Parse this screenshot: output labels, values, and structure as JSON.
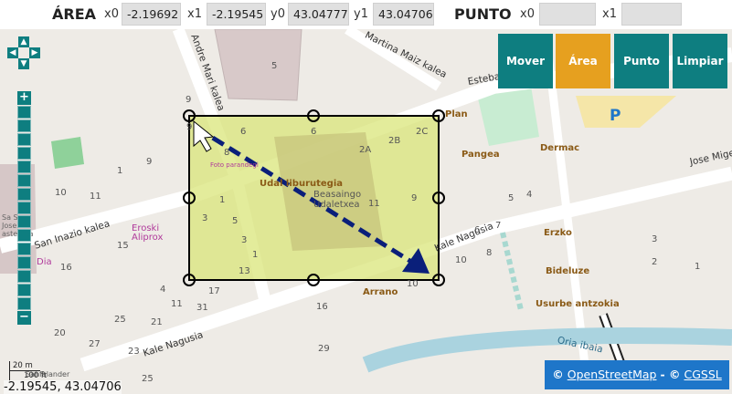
{
  "toolbar": {
    "area_label": "ÁREA",
    "x0_label": "x0",
    "x0_value": "-2.19692",
    "x1_label": "x1",
    "x1_value": "-2.19545",
    "y0_label": "y0",
    "y0_value": "43.04777",
    "y1_label": "y1",
    "y1_value": "43.04706",
    "punto_label": "PUNTO",
    "px0_label": "x0",
    "px0_value": "",
    "px1_label": "x1",
    "px1_value": ""
  },
  "buttons": {
    "mover": "Mover",
    "area": "Área",
    "punto": "Punto",
    "limpiar": "Limpiar"
  },
  "colors": {
    "button": "#0e7e80",
    "active_button": "#e6a01f",
    "selection_fill": "#d9e57a",
    "arrow": "#0a1f7a",
    "attribution": "#1e76c9"
  },
  "map": {
    "streets": {
      "andre": "Andre Mari kalea",
      "martina": "Martina Maiz kalea",
      "esteba": "Esteba",
      "san_inazio": "San Inazio kalea",
      "kale_nagusia_right": "Kale Nagusia",
      "kale_nagusia_left": "Kale Nagusia",
      "jose_miguel": "Jose Migel",
      "oria": "Oria ibaia",
      "sanfalander": "Sanfalander"
    },
    "pois": {
      "udal": "Udal liburutegia",
      "beasain": "Beasaingo",
      "udaletxea": "Udaletxea",
      "pangea": "Pangea",
      "dermac": "Dermac",
      "erzko": "Erzko",
      "bideluze": "Bideluze",
      "usurbe": "Usurbe antzokia",
      "arrano": "Arrano",
      "eroski": "Eroski",
      "aliprox": "Aliprox",
      "dia": "Dia",
      "plan": "Plan",
      "san_jose": "Sa Sa Jose astetxea",
      "parking": "P",
      "fotografia": "Foto parandegi"
    },
    "numbers": [
      "9",
      "5",
      "9",
      "1",
      "10",
      "11",
      "15",
      "16",
      "9",
      "6",
      "8",
      "6",
      "2A",
      "2B",
      "2C",
      "1",
      "5",
      "3",
      "3",
      "13",
      "1",
      "11",
      "9",
      "10",
      "10",
      "8",
      "7",
      "6",
      "5",
      "4",
      "3",
      "2",
      "1",
      "4",
      "11",
      "16",
      "17",
      "21",
      "25",
      "23",
      "27",
      "29",
      "25",
      "31",
      "20"
    ]
  },
  "scale": {
    "m": "20 m",
    "ft": "100 ft"
  },
  "attribution": {
    "prefix": "©",
    "osm": "OpenStreetMap",
    "sep": "- ©",
    "cgssl": "CGSSL"
  },
  "coords": "-2.19545, 43.04706"
}
